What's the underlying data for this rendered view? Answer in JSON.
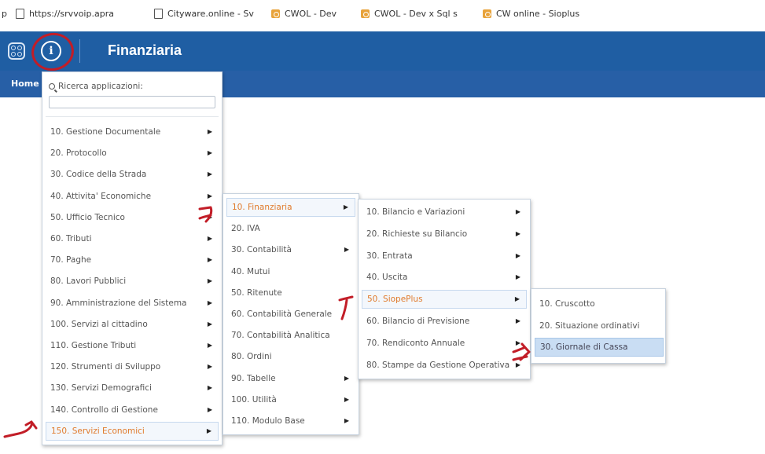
{
  "bookmarks": {
    "truncated_left": "p",
    "items": [
      {
        "label": "https://srvvoip.apra",
        "icon": "document-icon"
      },
      {
        "label": "Cityware.online - Sv",
        "icon": "document-icon"
      },
      {
        "label": "CWOL - Dev",
        "icon": "orange-app-icon"
      },
      {
        "label": "CWOL - Dev x Sql s",
        "icon": "orange-app-icon"
      },
      {
        "label": "CW online - Sioplus",
        "icon": "orange-app-icon"
      }
    ]
  },
  "header": {
    "title": "Finanziaria",
    "color": "#1f5ea3"
  },
  "nav": {
    "home": "Home"
  },
  "menu1": {
    "search_label": "Ricerca applicazioni:",
    "search_placeholder": "",
    "items": [
      {
        "label": "10. Gestione Documentale"
      },
      {
        "label": "20. Protocollo"
      },
      {
        "label": "30. Codice della Strada"
      },
      {
        "label": "40. Attivita' Economiche"
      },
      {
        "label": "50. Ufficio Tecnico"
      },
      {
        "label": "60. Tributi"
      },
      {
        "label": "70. Paghe"
      },
      {
        "label": "80. Lavori Pubblici"
      },
      {
        "label": "90. Amministrazione del Sistema"
      },
      {
        "label": "100. Servizi al cittadino"
      },
      {
        "label": "110. Gestione Tributi"
      },
      {
        "label": "120. Strumenti di Sviluppo"
      },
      {
        "label": "130. Servizi Demografici"
      },
      {
        "label": "140. Controllo di Gestione"
      },
      {
        "label": "150. Servizi Economici"
      }
    ],
    "active_index": 14
  },
  "menu2": {
    "items": [
      {
        "label": "10. Finanziaria",
        "submenu": true
      },
      {
        "label": "20. IVA",
        "submenu": false
      },
      {
        "label": "30. Contabilità",
        "submenu": true
      },
      {
        "label": "40. Mutui",
        "submenu": false
      },
      {
        "label": "50. Ritenute",
        "submenu": false
      },
      {
        "label": "60. Contabilità Generale",
        "submenu": false
      },
      {
        "label": "70. Contabilità Analitica",
        "submenu": false
      },
      {
        "label": "80. Ordini",
        "submenu": false
      },
      {
        "label": "90. Tabelle",
        "submenu": true
      },
      {
        "label": "100. Utilità",
        "submenu": true
      },
      {
        "label": "110. Modulo Base",
        "submenu": true
      }
    ],
    "active_index": 0
  },
  "menu3": {
    "items": [
      {
        "label": "10. Bilancio e Variazioni"
      },
      {
        "label": "20. Richieste su Bilancio"
      },
      {
        "label": "30. Entrata"
      },
      {
        "label": "40. Uscita"
      },
      {
        "label": "50. SiopePlus"
      },
      {
        "label": "60. Bilancio di Previsione"
      },
      {
        "label": "70. Rendiconto Annuale"
      },
      {
        "label": "80. Stampe da Gestione Operativa"
      }
    ],
    "active_index": 4
  },
  "menu4": {
    "items": [
      {
        "label": "10. Cruscotto"
      },
      {
        "label": "20. Situazione ordinativi"
      },
      {
        "label": "30. Giornale di Cassa"
      }
    ],
    "highlight_index": 2
  },
  "colors": {
    "active_text": "#e07a2b",
    "annotation": "#c21d27",
    "highlight": "#c9ddf3"
  }
}
